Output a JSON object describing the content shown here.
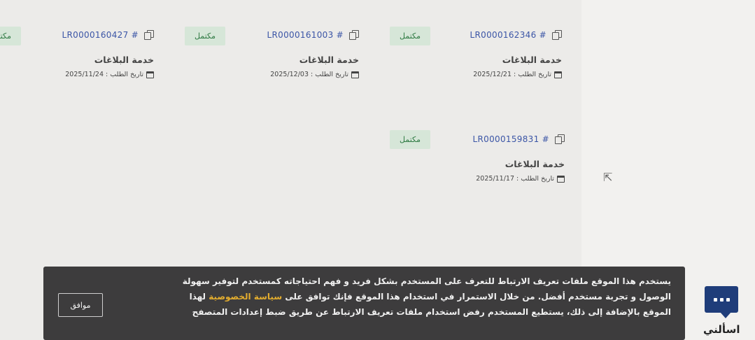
{
  "requests": [
    {
      "ref": "LR0000162346 #",
      "status": "مكتمل",
      "service": "خدمة البلاغات",
      "date": "تاريخ الطلب : 2025/12/21"
    },
    {
      "ref": "LR0000161003 #",
      "status": "مكتمل",
      "service": "خدمة البلاغات",
      "date": "تاريخ الطلب : 2025/12/03"
    },
    {
      "ref": "LR0000160427 #",
      "status": "مكتمل",
      "service": "خدمة البلاغات",
      "date": "تاريخ الطلب : 2025/11/24"
    },
    {
      "ref": "LR0000159831 #",
      "status": "مكتمل",
      "service": "خدمة البلاغات",
      "date": "تاريخ الطلب : 2025/11/17"
    }
  ],
  "cookie": {
    "text_before": "يستخدم هذا الموقع ملفات تعريف الارتباط للتعرف على المستخدم بشكل فريد و فهم احتياجاته كمستخدم لتوفير سهولة الوصول و تجربة مستخدم أفضل. من خلال الاستمرار في استخدام هذا الموقع فإنك توافق على",
    "link": "سياسة الخصوصية",
    "text_after": "لهذا الموقع بالإضافة إلى ذلك، يستطيع المستخدم رفض استخدام ملفات تعريف الارتباط عن طريق ضبط إعدادات المتصفح",
    "accept_label": "موافق"
  },
  "chat": {
    "label": "اسألني"
  }
}
